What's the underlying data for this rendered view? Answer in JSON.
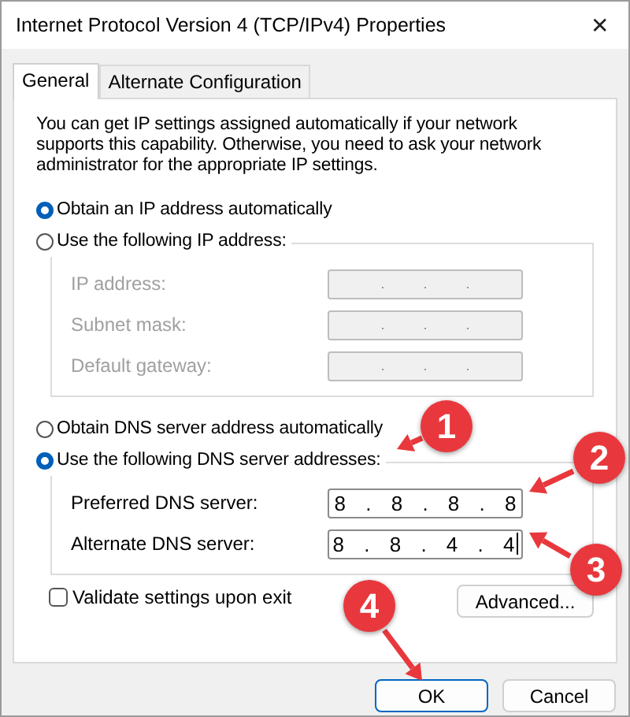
{
  "window": {
    "title": "Internet Protocol Version 4 (TCP/IPv4) Properties",
    "close": "✕"
  },
  "tabs": [
    {
      "label": "General",
      "selected": true
    },
    {
      "label": "Alternate Configuration",
      "selected": false
    }
  ],
  "intro": "You can get IP settings assigned automatically if your network supports this capability. Otherwise, you need to ask your network administrator for the appropriate IP settings.",
  "ip_mode": [
    {
      "label": "Obtain an IP address automatically",
      "selected": true
    },
    {
      "label": "Use the following IP address:",
      "selected": false
    }
  ],
  "ip_fields": {
    "disabled": true,
    "rows": [
      {
        "label": "IP address:",
        "value": ". . ."
      },
      {
        "label": "Subnet mask:",
        "value": ". . ."
      },
      {
        "label": "Default gateway:",
        "value": ". . ."
      }
    ]
  },
  "dns_mode": [
    {
      "label": "Obtain DNS server address automatically",
      "selected": false
    },
    {
      "label": "Use the following DNS server addresses:",
      "selected": true
    }
  ],
  "dns_fields": {
    "disabled": false,
    "rows": [
      {
        "label": "Preferred DNS server:",
        "value": "8 . 8 . 8 . 8"
      },
      {
        "label": "Alternate DNS server:",
        "value": "8 . 8 . 4 . 4",
        "focused": true
      }
    ]
  },
  "validate": {
    "label": "Validate settings upon exit",
    "checked": false
  },
  "advanced_button": "Advanced...",
  "buttons": [
    {
      "label": "OK",
      "default": true
    },
    {
      "label": "Cancel",
      "default": false
    }
  ],
  "annotations": [
    {
      "label": "1"
    },
    {
      "label": "2"
    },
    {
      "label": "3"
    },
    {
      "label": "4"
    }
  ]
}
